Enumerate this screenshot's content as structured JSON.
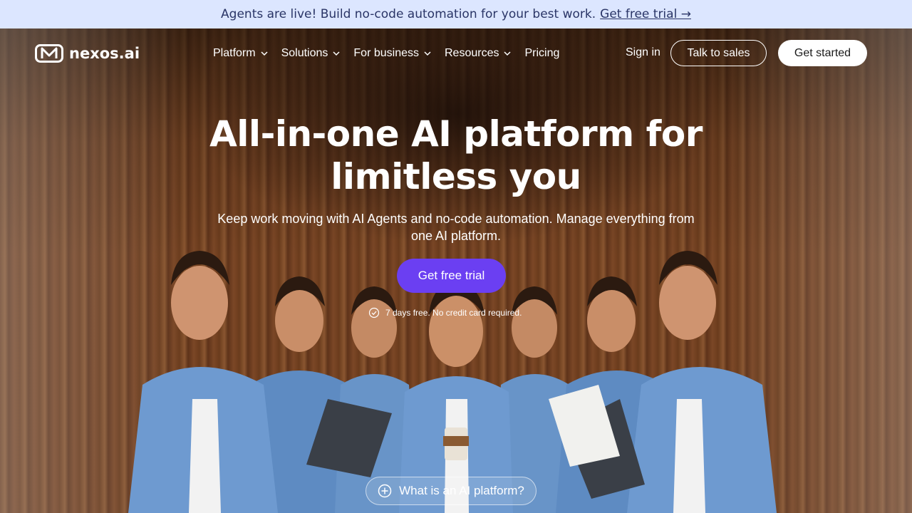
{
  "banner": {
    "text": "Agents are live! Build no-code automation for your best work.",
    "link": "Get free trial →"
  },
  "nav": {
    "logo_text": "nexos.ai",
    "menu": [
      {
        "label": "Platform",
        "has_dropdown": true
      },
      {
        "label": "Solutions",
        "has_dropdown": true
      },
      {
        "label": "For business",
        "has_dropdown": true
      },
      {
        "label": "Resources",
        "has_dropdown": true
      },
      {
        "label": "Pricing",
        "has_dropdown": false
      }
    ],
    "signin": "Sign in",
    "talk_to_sales": "Talk to sales",
    "get_started": "Get started"
  },
  "hero": {
    "headline_line1": "All-in-one AI platform for",
    "headline_line2": "limitless you",
    "subtext": "Keep work moving with AI Agents and no-code automation. Manage everything from one AI platform.",
    "cta": "Get free trial",
    "note": "7 days free. No credit card required.",
    "what_is": "What is an AI platform?"
  },
  "colors": {
    "banner_bg": "#dce6ff",
    "cta_purple": "#6b3ff2",
    "wood": "#6b3d1e"
  }
}
